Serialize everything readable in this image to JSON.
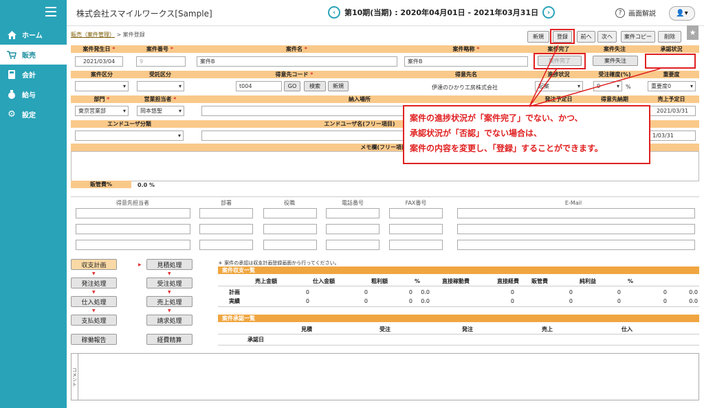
{
  "app": {
    "company": "株式会社スマイルワークス[Sample]",
    "period": "第10期(当期) : 2020年04月01日 - 2021年03月31日",
    "help": "画面解説"
  },
  "sidebar": {
    "items": [
      {
        "label": "ホーム"
      },
      {
        "label": "販売"
      },
      {
        "label": "会計"
      },
      {
        "label": "給与"
      },
      {
        "label": "設定"
      }
    ]
  },
  "breadcrumb": {
    "parent": "販売（案件管理）",
    "sep": ">",
    "current": "案件登録"
  },
  "toolbar": {
    "new": "新規",
    "register": "登録",
    "prev": "前へ",
    "next": "次へ",
    "copy": "案件コピー",
    "delete": "削除"
  },
  "form": {
    "h_date": "案件発生日",
    "h_no": "案件番号",
    "h_name": "案件名",
    "h_abbr": "案件略称",
    "h_done": "案件完了",
    "h_lost": "案件失注",
    "h_approval": "承認状況",
    "date": "2021/03/04",
    "no": "9",
    "name": "案件B",
    "abbr": "案件B",
    "done_btn": "案件完了",
    "lost_btn": "案件失注",
    "h_kubun": "案件区分",
    "h_jutaku": "受託区分",
    "h_custcode": "得意先コード",
    "h_custname": "得意先名",
    "h_progress": "進捗状況",
    "h_prob": "受注確度(%)",
    "h_importance": "重要度",
    "custcode": "t004",
    "go": "GO",
    "search": "検索",
    "new": "新規",
    "custname": "伊達のひかり工房株式会社",
    "progress": "起案",
    "prob": "0",
    "pct": "%",
    "importance": "重要度0",
    "h_dept": "部門",
    "h_rep": "営業担当者",
    "h_delivery": "納入場所",
    "h_ship": "発注予定日",
    "h_custdue": "得意先納期",
    "h_salesdue": "売上予定日",
    "dept": "東京営業部",
    "rep": "岡本悠聖",
    "salesdue": "2021/03/31",
    "h_enduser": "エンドユーザ分類",
    "h_enduserfree": "エンドユーザ名(フリー項目)",
    "due2": "1/03/31",
    "h_memo": "メモ欄(フリー項目)",
    "h_sga": "販管費%",
    "sga": "0.0 %"
  },
  "callout": {
    "line1": "案件の進捗状況が「案件完了」でない、かつ、",
    "line2": "承認状況が「否認」でない場合は、",
    "line3": "案件の内容を変更し、「登録」することができます。"
  },
  "contacts": {
    "headers": [
      "得意先担当者",
      "部署",
      "役職",
      "電話番号",
      "FAX番号",
      "E-Mail"
    ]
  },
  "process": {
    "b1": "収支計画",
    "b2": "見積処理",
    "b3": "発注処理",
    "b4": "受注処理",
    "b5": "仕入処理",
    "b6": "売上処理",
    "b7": "支払処理",
    "b8": "請求処理",
    "b9": "稼働報告",
    "b10": "経費精算"
  },
  "note": "＊ 案件の承認は収支計画登録画面から行ってください。",
  "balance": {
    "title": "案件収支一覧",
    "headers": [
      "売上金額",
      "仕入金額",
      "粗利額",
      "%",
      "直接稼動費",
      "直接経費",
      "販管費",
      "純利益",
      "%"
    ],
    "rows": [
      {
        "label": "計画",
        "values": [
          "0",
          "0",
          "0",
          "0.0",
          "0",
          "0",
          "0",
          "0",
          "0.0"
        ]
      },
      {
        "label": "実績",
        "values": [
          "0",
          "0",
          "0",
          "0.0",
          "0",
          "0",
          "0",
          "0",
          "0.0"
        ]
      }
    ]
  },
  "approval": {
    "title": "案件承認一覧",
    "headers": [
      "見積",
      "受注",
      "発注",
      "売上",
      "仕入"
    ],
    "row_label": "承認日"
  },
  "comment_label": "コメント"
}
